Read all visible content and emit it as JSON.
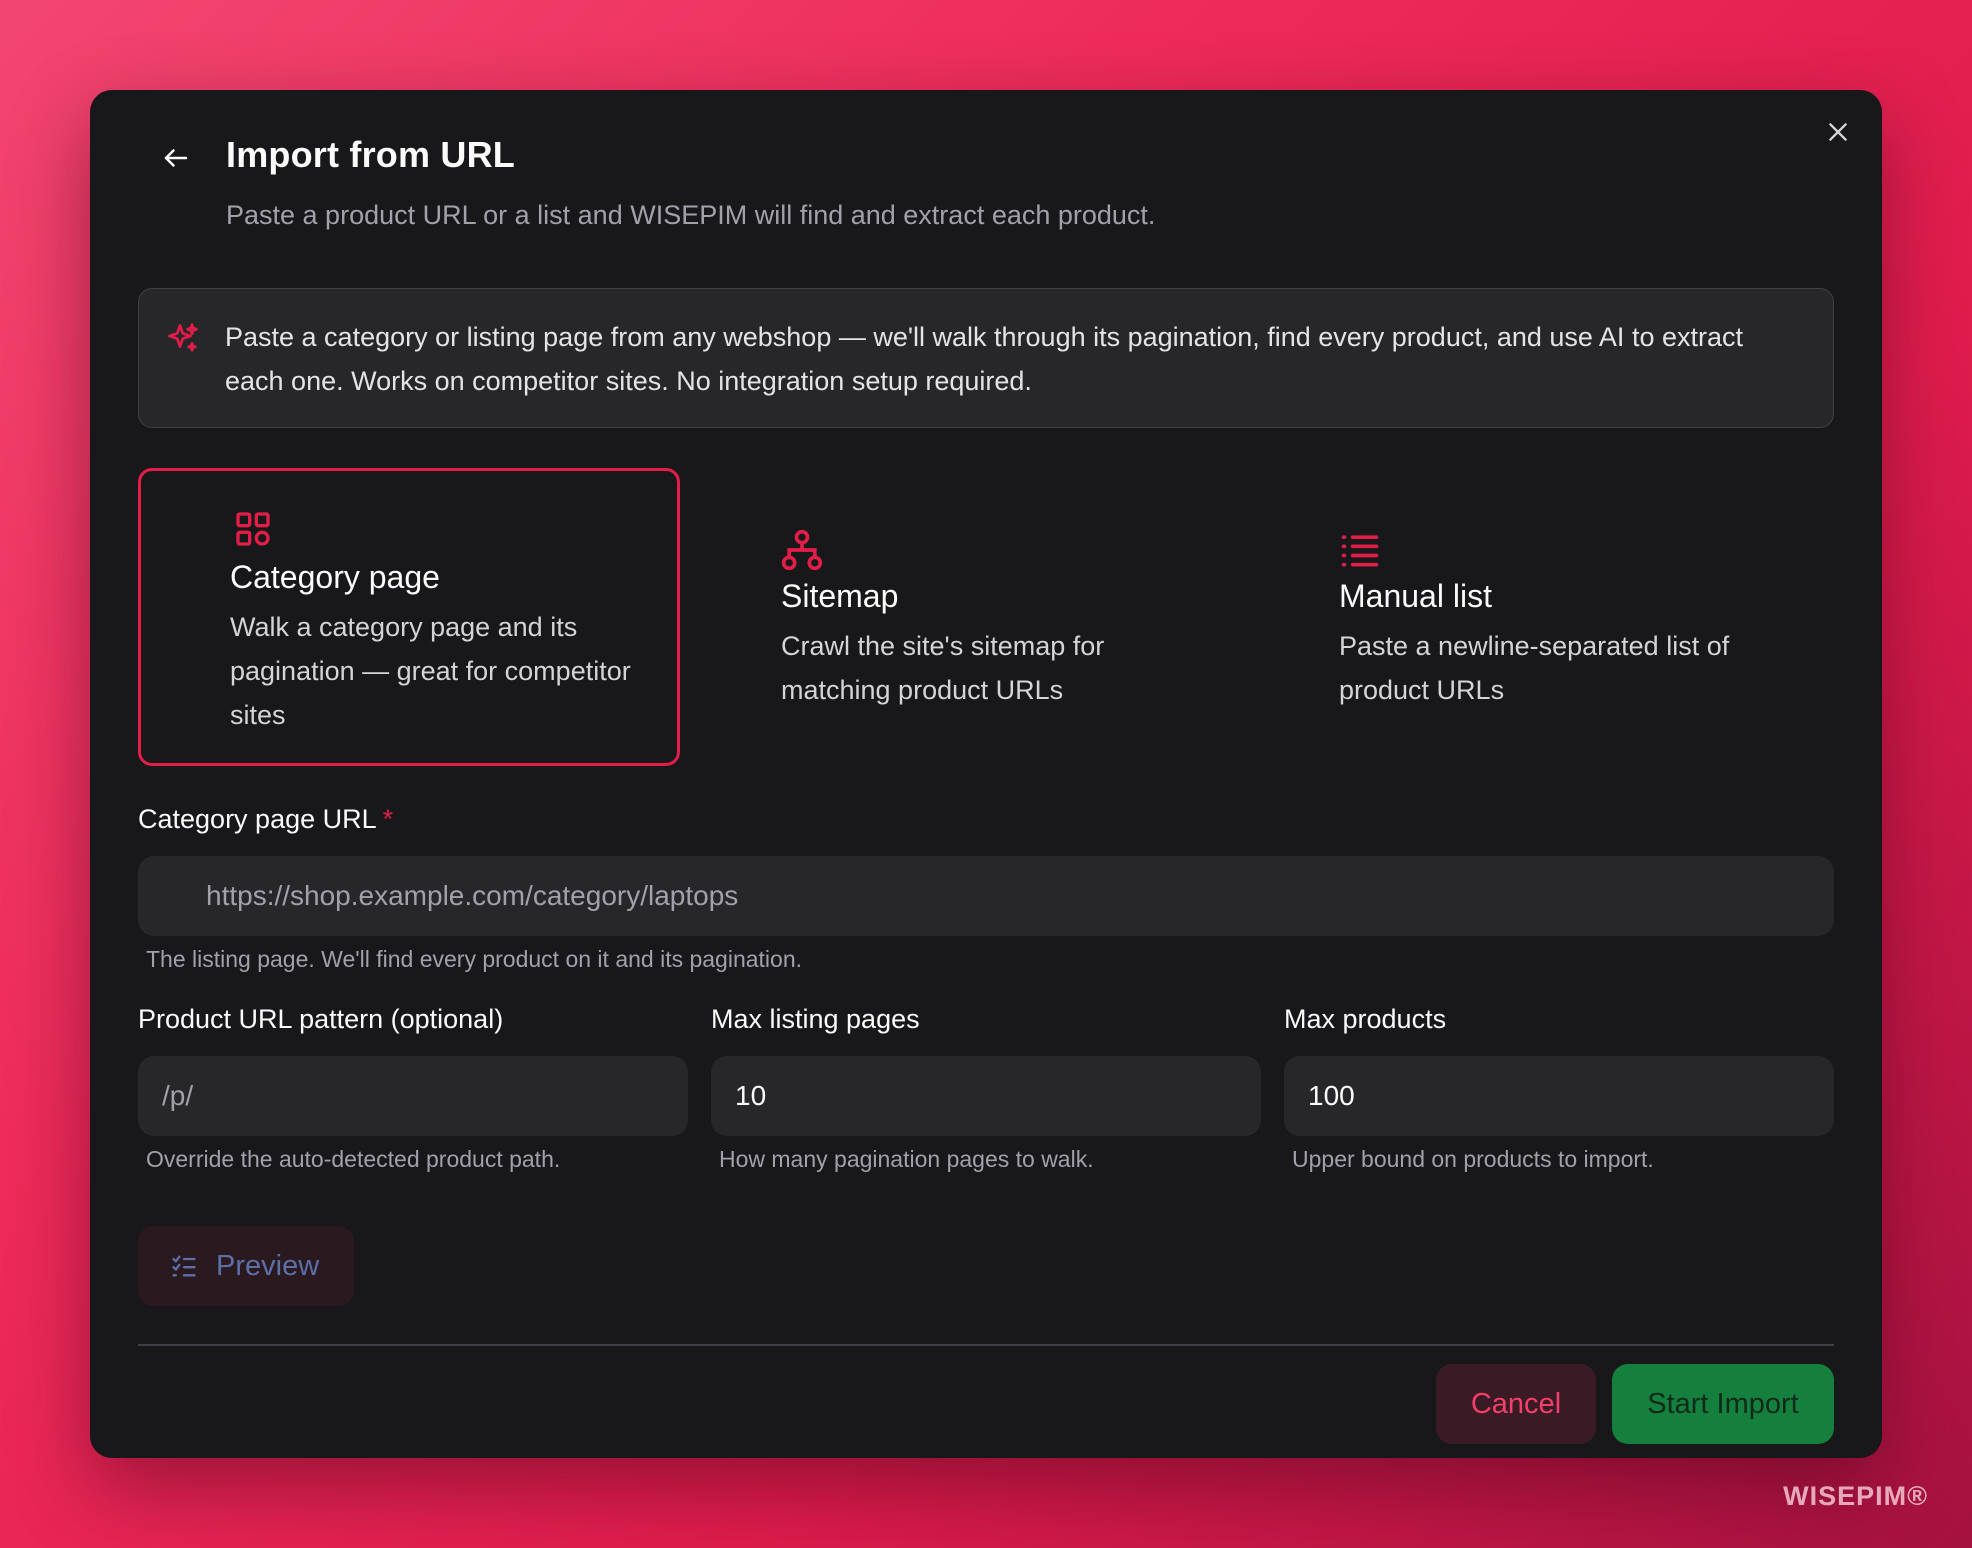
{
  "modal": {
    "title": "Import from URL",
    "subtitle": "Paste a product URL or a list and WISEPIM will find and extract each product."
  },
  "info": {
    "text": "Paste a category or listing page from any webshop — we'll walk through its pagination, find every product, and use AI to extract each one. Works on competitor sites. No integration setup required."
  },
  "options": [
    {
      "id": "category",
      "title": "Category page",
      "description": "Walk a category page and its pagination — great for competitor sites",
      "icon": "grid-icon",
      "selected": true
    },
    {
      "id": "sitemap",
      "title": "Sitemap",
      "description": "Crawl the site's sitemap for matching product URLs",
      "icon": "sitemap-icon",
      "selected": false
    },
    {
      "id": "manual",
      "title": "Manual list",
      "description": "Paste a newline-separated list of product URLs",
      "icon": "list-icon",
      "selected": false
    }
  ],
  "form": {
    "url": {
      "label": "Category page URL",
      "required_mark": "*",
      "placeholder": "https://shop.example.com/category/laptops",
      "value": "",
      "hint": "The listing page. We'll find every product on it and its pagination."
    },
    "pattern": {
      "label": "Product URL pattern (optional)",
      "placeholder": "/p/",
      "value": "",
      "hint": "Override the auto-detected product path."
    },
    "max_pages": {
      "label": "Max listing pages",
      "value": "10",
      "hint": "How many pagination pages to walk."
    },
    "max_products": {
      "label": "Max products",
      "value": "100",
      "hint": "Upper bound on products to import."
    }
  },
  "actions": {
    "preview_label": "Preview",
    "cancel_label": "Cancel",
    "start_label": "Start Import"
  },
  "colors": {
    "accent": "#e11d48",
    "success": "#15803d",
    "modal_bg": "#18181b"
  },
  "brand": "WISEPIM®"
}
